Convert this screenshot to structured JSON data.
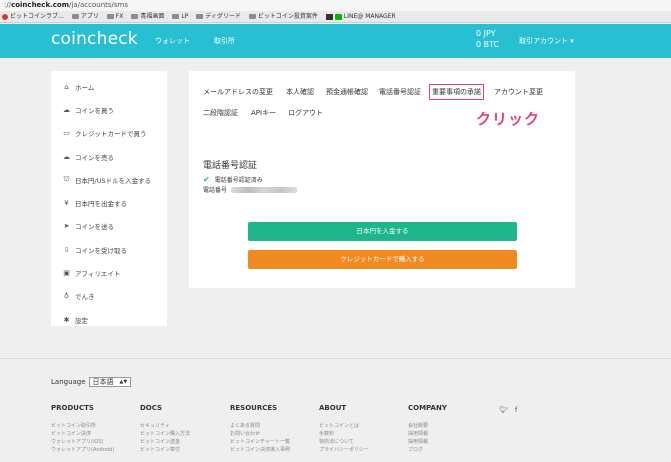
{
  "browser": {
    "url_prefix": "://",
    "url_domain": "coincheck.com",
    "url_path": "/ja/accounts/sms",
    "bookmarks": [
      "ビットコインラブ...",
      "アプリ",
      "FX",
      "青福画面",
      "LP",
      "ディグリード",
      "ビットコイン投資案件",
      "LINE@ MANAGER"
    ]
  },
  "header": {
    "logo": "coincheck",
    "nav": [
      "ウォレット",
      "取引所"
    ],
    "balance_jpy": "0 JPY",
    "balance_btc": "0 BTC",
    "account_menu": "取引アカウント ▾",
    "bg_color": "#29bfd2"
  },
  "sidebar": {
    "items": [
      {
        "label": "ホーム",
        "icon": "home-icon",
        "glyph": "⌂"
      },
      {
        "label": "コインを買う",
        "icon": "cloud-download-icon",
        "glyph": "☁"
      },
      {
        "label": "クレジットカードで買う",
        "icon": "credit-card-icon",
        "glyph": "▭"
      },
      {
        "label": "コインを売る",
        "icon": "cloud-upload-icon",
        "glyph": "☁"
      },
      {
        "label": "日本円/USドルを入金する",
        "icon": "bank-icon",
        "glyph": "⛫"
      },
      {
        "label": "日本円を出金する",
        "icon": "yen-icon",
        "glyph": "¥"
      },
      {
        "label": "コインを送る",
        "icon": "send-icon",
        "glyph": "➤"
      },
      {
        "label": "コインを受け取る",
        "icon": "download-icon",
        "glyph": "⇩"
      },
      {
        "label": "アフィリエイト",
        "icon": "gift-icon",
        "glyph": "▣"
      },
      {
        "label": "でんき",
        "icon": "lightbulb-icon",
        "glyph": "♁"
      },
      {
        "label": "設定",
        "icon": "gear-icon",
        "glyph": "✱"
      }
    ]
  },
  "main": {
    "tabs_row1": [
      "メールアドレスの変更",
      "本人確認",
      "預金通帳確認",
      "電話番号認証",
      "重要事項の承諾",
      "アカウント変更"
    ],
    "tabs_row2": [
      "二段階認証",
      "APIキー",
      "ログアウト"
    ],
    "annotation": "クリック",
    "annotation_color": "#e2417d",
    "section_title": "電話番号認証",
    "verified_text": "電話番号認証済み",
    "phone_label": "電話番号",
    "btn_deposit": "日本円を入金する",
    "btn_credit": "クレジットカードで購入する",
    "deposit_color": "#1fb68c",
    "credit_color": "#f18a21"
  },
  "footer": {
    "language_label": "Language",
    "language_value": "日本語",
    "columns": [
      {
        "head": "PRODUCTS",
        "links": [
          "ビットコイン取引所",
          "ビットコイン決済",
          "ウォレットアプリ(iOS)",
          "ウォレットアプリ(Android)"
        ]
      },
      {
        "head": "DOCS",
        "links": [
          "セキュリティ",
          "ビットコイン購入方法",
          "ビットコイン送金",
          "ビットコイン寄付"
        ]
      },
      {
        "head": "RESOURCES",
        "links": [
          "よくある質問",
          "お問い合わせ",
          "ビットコインチャート一覧",
          "ビットコイン決済導入事例"
        ]
      },
      {
        "head": "ABOUT",
        "links": [
          "ビットコインとは",
          "手数料",
          "特商法について",
          "プライバシーポリシー"
        ]
      },
      {
        "head": "COMPANY",
        "links": [
          "会社概要",
          "採用情報",
          "採用情報",
          "ブログ"
        ]
      }
    ],
    "social": [
      "twitter-icon",
      "facebook-icon"
    ]
  }
}
